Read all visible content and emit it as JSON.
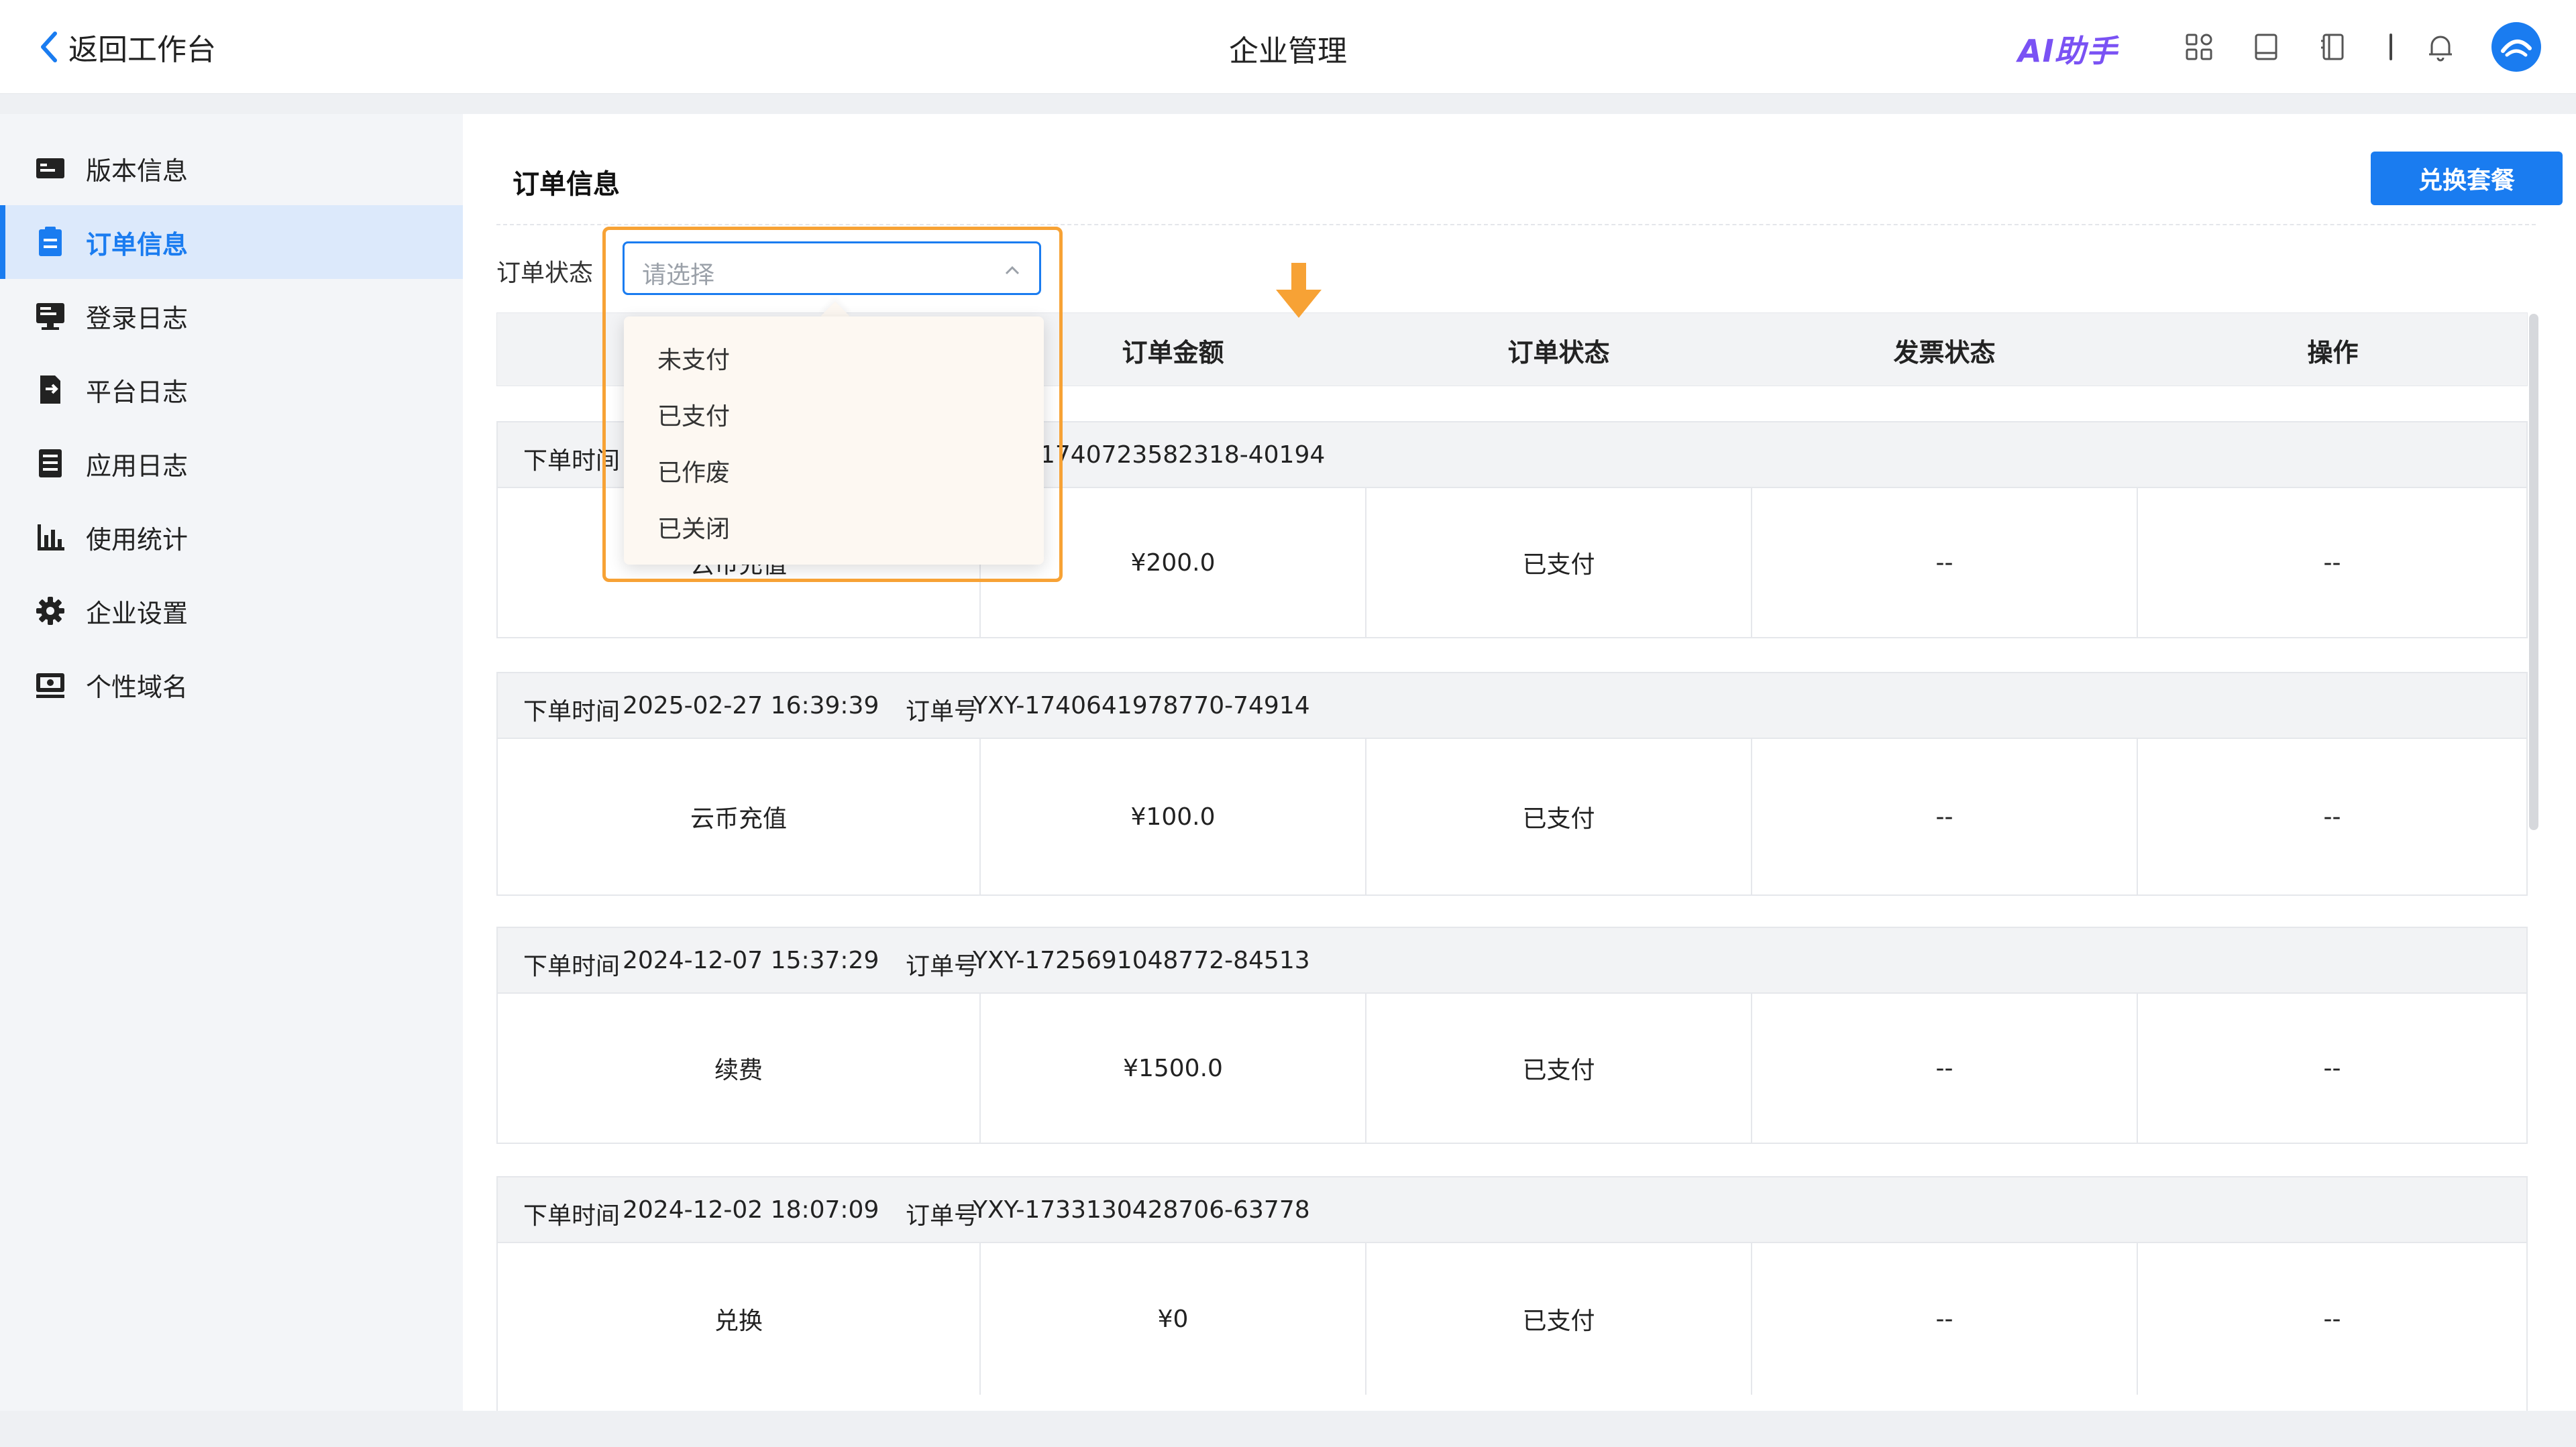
{
  "header": {
    "back_label": "返回工作台",
    "title": "企业管理",
    "ai_label": "AI助手",
    "icons": [
      "apps-icon",
      "book-icon",
      "notebook-icon",
      "bell-icon"
    ],
    "avatar": "avatar-logo-icon"
  },
  "sidebar": {
    "items": [
      {
        "label": "版本信息",
        "icon": "card-icon"
      },
      {
        "label": "订单信息",
        "icon": "order-icon",
        "active": true
      },
      {
        "label": "登录日志",
        "icon": "monitor-icon"
      },
      {
        "label": "平台日志",
        "icon": "doc-export-icon"
      },
      {
        "label": "应用日志",
        "icon": "list-icon"
      },
      {
        "label": "使用统计",
        "icon": "bar-chart-icon"
      },
      {
        "label": "企业设置",
        "icon": "gear-icon"
      },
      {
        "label": "个性域名",
        "icon": "domain-icon"
      }
    ]
  },
  "main": {
    "section_title": "订单信息",
    "exchange_button": "兑换套餐",
    "filter": {
      "label": "订单状态",
      "placeholder": "请选择",
      "options": [
        "未支付",
        "已支付",
        "已作废",
        "已关闭"
      ]
    },
    "columns": [
      "订单金额",
      "订单状态",
      "发票状态",
      "操作"
    ],
    "orders": [
      {
        "time_prefix": "下单时间",
        "time": "",
        "order_no_tail": "1740723582318-40194",
        "product": "云币充值",
        "amount": "¥200.0",
        "status": "已支付",
        "invoice": "--",
        "action": "--"
      },
      {
        "time_prefix": "下单时间",
        "time": "2025-02-27 16:39:39",
        "order_label": "订单号",
        "order_no": "YXY-1740641978770-74914",
        "product": "云币充值",
        "amount": "¥100.0",
        "status": "已支付",
        "invoice": "--",
        "action": "--"
      },
      {
        "time_prefix": "下单时间",
        "time": "2024-12-07 15:37:29",
        "order_label": "订单号",
        "order_no": "YXY-1725691048772-84513",
        "product": "续费",
        "amount": "¥1500.0",
        "status": "已支付",
        "invoice": "--",
        "action": "--"
      },
      {
        "time_prefix": "下单时间",
        "time": "2024-12-02 18:07:09",
        "order_label": "订单号",
        "order_no": "YXY-1733130428706-63778",
        "product": "兑换",
        "amount": "¥0",
        "status": "已支付",
        "invoice": "--",
        "action": "--"
      }
    ]
  },
  "colors": {
    "primary": "#1a7cf0",
    "highlight": "#f7a235",
    "ai": "#7a52f4"
  }
}
